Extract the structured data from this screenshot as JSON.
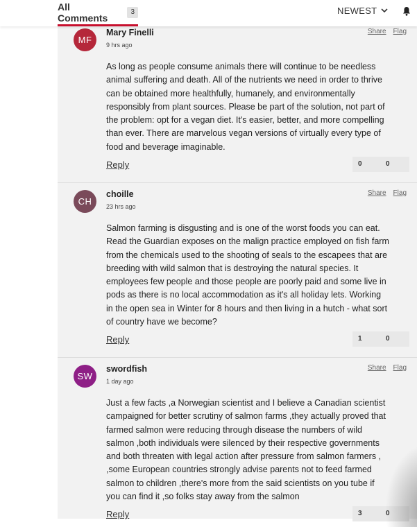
{
  "header": {
    "tab_label": "All Comments",
    "count": "3",
    "sort_label": "NEWEST"
  },
  "comments": [
    {
      "initials": "MF",
      "avatar_color": "#b5273a",
      "author": "Mary Finelli",
      "time": "9 hrs ago",
      "share": "Share",
      "flag": "Flag",
      "lines": [
        "As long as people consume animals there will continue to be needless",
        "animal suffering and death. All of the nutrients we need in order to thrive",
        "can be obtained more healthfully, humanely, and environmentally",
        "responsibly from plant sources. Please be part of the solution, not part of",
        "the problem: opt for a vegan diet. It's easier, better, and more compelling",
        "than ever. There are marvelous vegan versions of virtually every type of",
        "food and beverage imaginable."
      ],
      "reply": "Reply",
      "up": "0",
      "down": "0"
    },
    {
      "initials": "CH",
      "avatar_color": "#7a4a5a",
      "author": "choille",
      "time": "23 hrs ago",
      "share": "Share",
      "flag": "Flag",
      "lines": [
        "Salmon farming is disgusting and is one of the worst foods you can eat.",
        "Read the Guardian exposes on the malign practice employed on fish farm",
        "from the chemicals used to the shooting of seals to the escapees that are",
        "breeding with wild salmon that is destroying the natural species. It",
        "employees few people and those people are poorly paid and some live in",
        "pods as there is no local accommodation as it's all holiday lets. Working",
        "in the open sea in Winter for 8 hours and then living in a hutch - what sort",
        "of country have we become?"
      ],
      "reply": "Reply",
      "up": "1",
      "down": "0"
    },
    {
      "initials": "SW",
      "avatar_color": "#8e1f86",
      "author": "swordfish",
      "time": "1 day ago",
      "share": "Share",
      "flag": "Flag",
      "lines": [
        "Just a few facts ,a Norwegian scientist and I believe a Canadian scientist",
        "campaigned for better scrutiny of salmon farms ,they actually proved that",
        "farmed salmon were reducing through disease the numbers of wild",
        "salmon ,both individuals were silenced by their respective governments",
        "and both threaten with legal action after pressure from salmon farmers ,",
        ",some European countries strongly advise parents not to feed farmed",
        "salmon to children ,there's more from the said scientists on you tube if",
        "you can find it ,so folks stay away from the salmon"
      ],
      "reply": "Reply",
      "up": "3",
      "down": "0"
    }
  ]
}
